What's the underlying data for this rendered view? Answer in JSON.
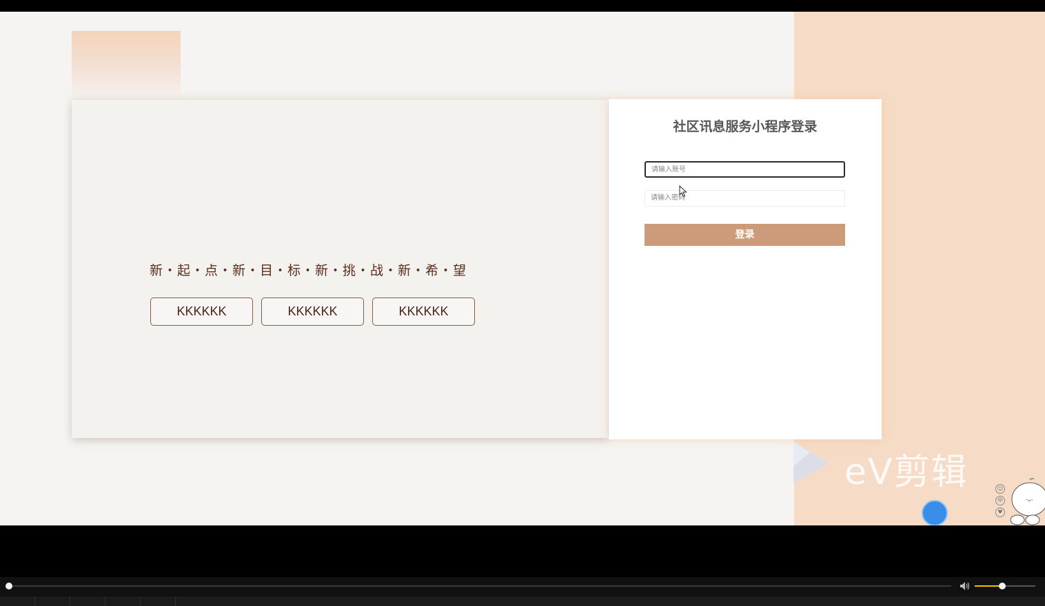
{
  "login": {
    "title": "社区讯息服务小程序登录",
    "account_placeholder": "请输入账号",
    "password_placeholder": "请输入密码",
    "submit_label": "登录"
  },
  "hero": {
    "slogan": "新・起・点・新・目・标・新・挑・战・新・希・望",
    "buttons": [
      {
        "label": "KKKKKK"
      },
      {
        "label": "KKKKKK"
      },
      {
        "label": "KKKKKK"
      }
    ]
  },
  "watermark": {
    "text": "eV剪辑"
  },
  "player": {
    "progress": 0,
    "volume": 0.45
  },
  "colors": {
    "accent": "#cc9c7a",
    "peach": "#f6dcc6",
    "slogan": "#5a2e1c"
  },
  "icons": [
    "cursor-icon",
    "ev-play-logo-icon",
    "volume-icon",
    "mascot-icon"
  ]
}
